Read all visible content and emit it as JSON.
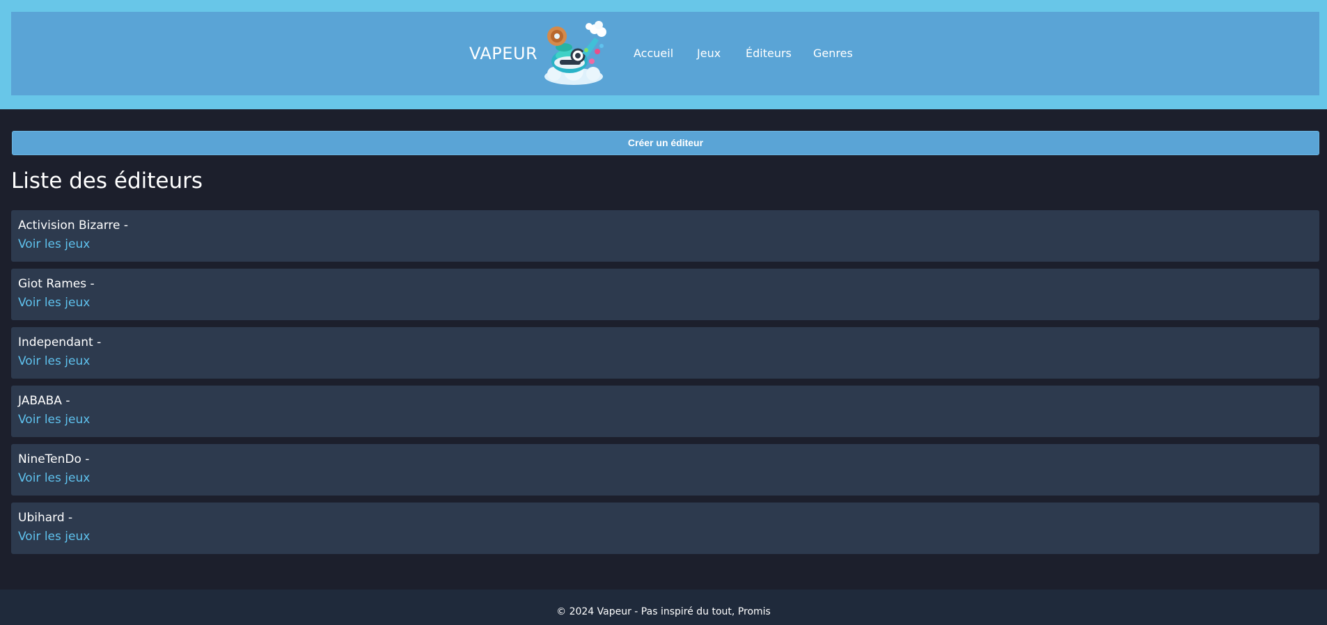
{
  "header": {
    "brand": "VAPEUR",
    "logo_icon": "steam-teapot-logo-icon",
    "nav": [
      {
        "label": "Accueil"
      },
      {
        "label": "Jeux"
      },
      {
        "label": "Éditeurs"
      },
      {
        "label": "Genres"
      }
    ]
  },
  "main": {
    "create_button_label": "Créer un éditeur",
    "title": "Liste des éditeurs",
    "publishers": [
      {
        "name": "Activision Bizarre -",
        "link": "Voir les jeux"
      },
      {
        "name": "Giot Rames -",
        "link": "Voir les jeux"
      },
      {
        "name": "Independant -",
        "link": "Voir les jeux"
      },
      {
        "name": "JABABA -",
        "link": "Voir les jeux"
      },
      {
        "name": "NineTenDo -",
        "link": "Voir les jeux"
      },
      {
        "name": "Ubihard -",
        "link": "Voir les jeux"
      }
    ]
  },
  "footer": {
    "text": "© 2024 Vapeur - Pas inspiré du tout, Promis"
  },
  "colors": {
    "header_outer": "#68c6e8",
    "header_inner": "#5aa4d6",
    "background": "#1c1f2c",
    "card": "#2d3a4e",
    "link": "#5fc2ee",
    "footer": "#1f2a3b"
  }
}
